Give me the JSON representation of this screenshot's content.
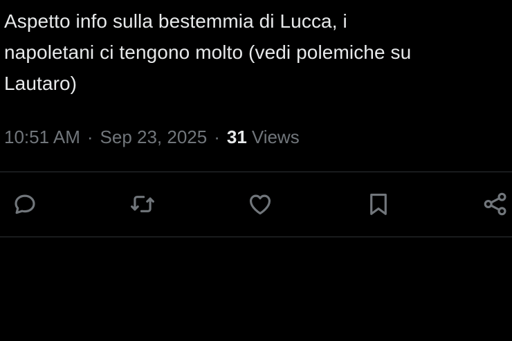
{
  "post": {
    "text_lines": [
      "Aspetto info sulla bestemmia di Lucca, i",
      "napoletani ci tengono molto (vedi polemiche su",
      "Lautaro)"
    ],
    "time": "10:51 AM",
    "separator": "·",
    "date": "Sep 23, 2025",
    "views_count": "31",
    "views_label": "Views"
  },
  "actions": {
    "reply_icon": "reply-icon",
    "repost_icon": "repost-icon",
    "like_icon": "heart-icon",
    "bookmark_icon": "bookmark-icon",
    "share_icon": "share-icon"
  },
  "colors": {
    "background": "#000000",
    "text": "#e7e9ea",
    "secondary_text": "#71767b",
    "divider": "#2f3336"
  }
}
